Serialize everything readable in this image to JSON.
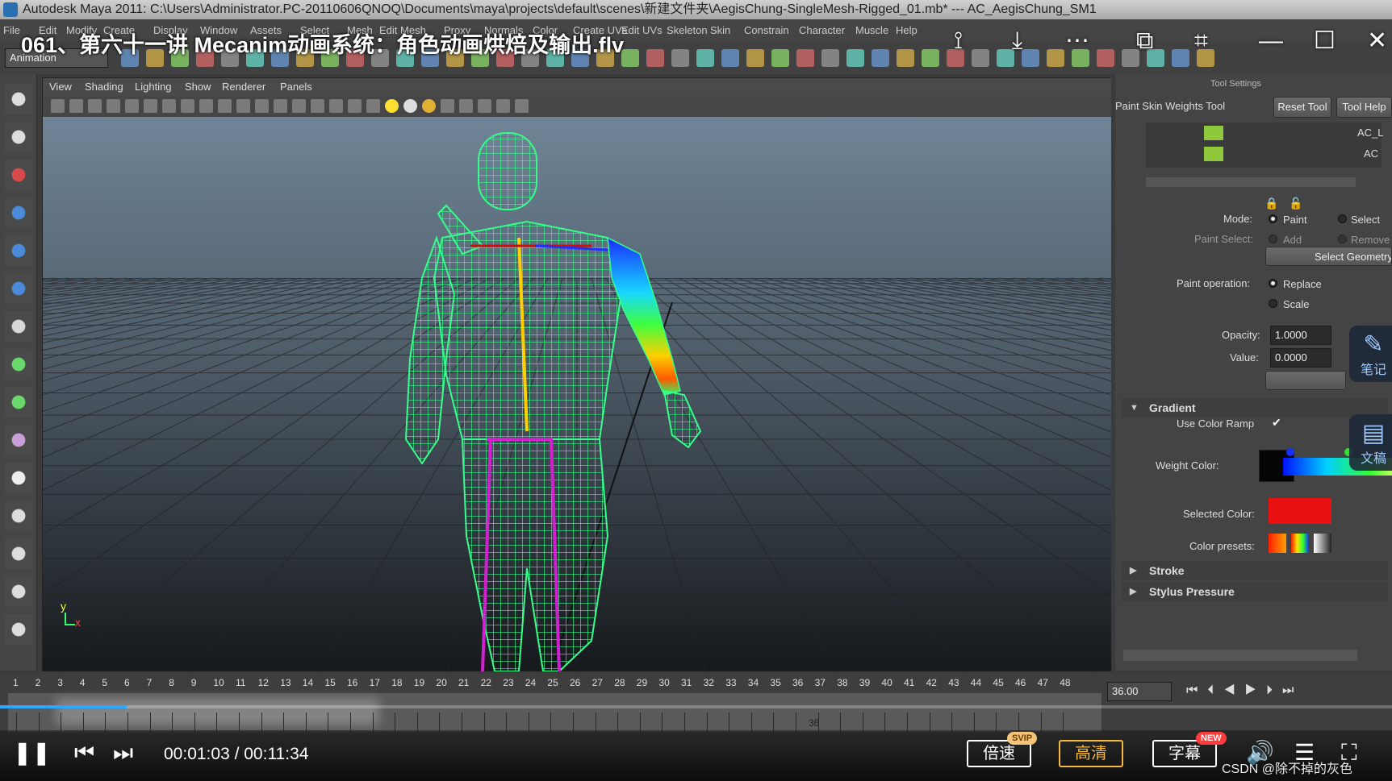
{
  "window": {
    "title": "Autodesk Maya 2011: C:\\Users\\Administrator.PC-20110606QNOQ\\Documents\\maya\\projects\\default\\scenes\\新建文件夹\\AegisChung-SingleMesh-Rigged_01.mb*  ---  AC_AegisChung_SM1"
  },
  "menubar": {
    "items": [
      "File",
      "Edit",
      "Modify",
      "Create",
      "Display",
      "Window",
      "Assets",
      "Select",
      "Mesh",
      "Edit Mesh",
      "Proxy",
      "Normals",
      "Color",
      "Create UVs",
      "Edit UVs",
      "Skeleton",
      "Skin",
      "Constrain",
      "Character",
      "Muscle",
      "Help"
    ],
    "mode_select": "Animation"
  },
  "video_title": "061、第六十一讲 Mecanim动画系统：角色动画烘焙及输出.flv",
  "overlay_icons": [
    "share-icon",
    "download-icon",
    "more-icon",
    "pip-icon",
    "crop-icon",
    "minimize-icon",
    "maximize-icon",
    "close-icon"
  ],
  "viewport": {
    "menu": [
      "View",
      "Shading",
      "Lighting",
      "Show",
      "Renderer",
      "Panels"
    ],
    "axis_y": "y",
    "axis_x": "x"
  },
  "tool_settings": {
    "panel_title": "Tool Settings",
    "tool_name": "Paint Skin Weights Tool",
    "reset_button": "Reset Tool",
    "help_button": "Tool Help",
    "influences": [
      "AC_L",
      "AC"
    ],
    "mode_label": "Mode:",
    "mode_paint": "Paint",
    "mode_select": "Select",
    "paint_select_label": "Paint Select:",
    "paint_select_add": "Add",
    "paint_select_remove": "Remove",
    "select_geometry_button": "Select Geometry",
    "paint_operation_label": "Paint operation:",
    "op_replace": "Replace",
    "op_scale": "Scale",
    "opacity_label": "Opacity:",
    "opacity_value": "1.0000",
    "value_label": "Value:",
    "value_value": "0.0000",
    "gradient_section": "Gradient",
    "use_color_ramp_label": "Use Color Ramp",
    "use_color_ramp_checked": true,
    "weight_color_label": "Weight Color:",
    "selected_color_label": "Selected Color:",
    "selected_color": "#e81010",
    "color_presets_label": "Color presets:",
    "stroke_section": "Stroke",
    "stylus_section": "Stylus Pressure"
  },
  "side_float": {
    "notes_label": "笔记",
    "doc_label": "文稿"
  },
  "timeline": {
    "frames": [
      "1",
      "2",
      "3",
      "4",
      "5",
      "6",
      "7",
      "8",
      "9",
      "10",
      "11",
      "12",
      "13",
      "14",
      "15",
      "16",
      "17",
      "18",
      "19",
      "20",
      "21",
      "22",
      "23",
      "24",
      "25",
      "26",
      "27",
      "28",
      "29",
      "30",
      "31",
      "32",
      "33",
      "34",
      "35",
      "36",
      "37",
      "38",
      "39",
      "40",
      "41",
      "42",
      "43",
      "44",
      "45",
      "46",
      "47",
      "48"
    ],
    "current_frame": "36.00",
    "current_marker": "36"
  },
  "player": {
    "time": "00:01:03 / 00:11:34",
    "progress": 0.0908,
    "speed_label": "倍速",
    "speed_tag": "SVIP",
    "quality_label": "高清",
    "subtitle_label": "字幕",
    "subtitle_tag": "NEW",
    "watermark": "CSDN @除不掉的灰色"
  }
}
